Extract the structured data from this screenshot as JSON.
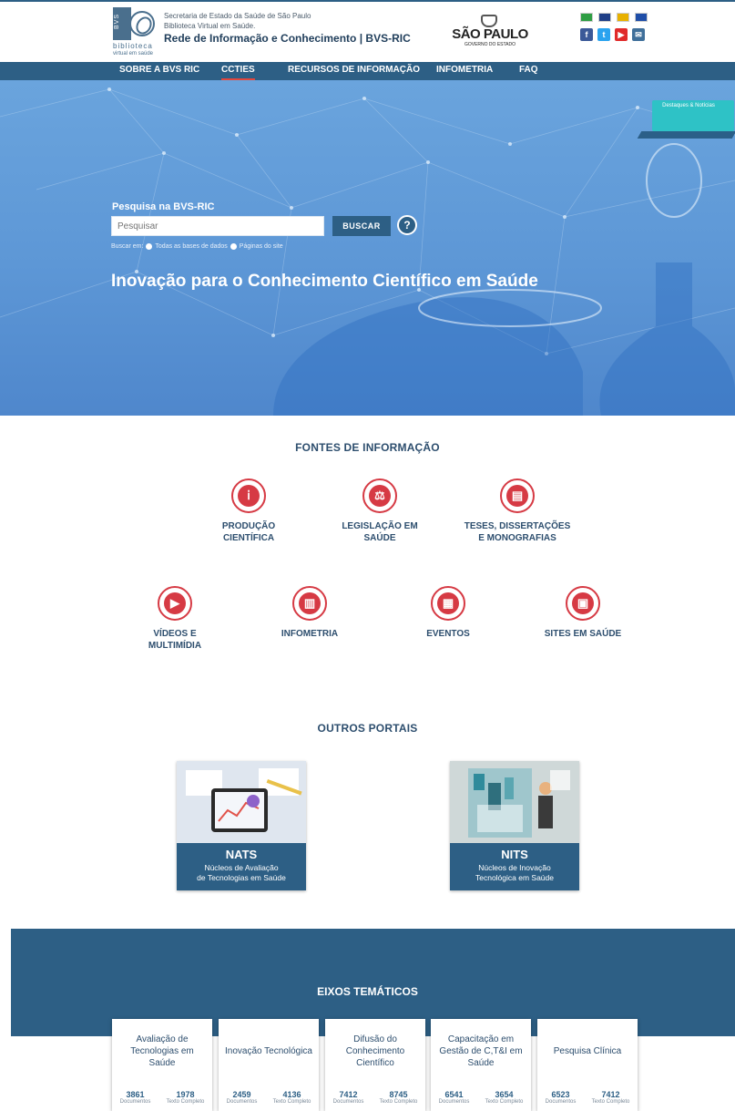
{
  "header": {
    "logo_vertical": "BVS",
    "logo_sub1": "biblioteca",
    "logo_sub2": "virtual em saúde",
    "inst_line1": "Secretaria de Estado da Saúde de São Paulo",
    "inst_line2": "Biblioteca Virtual em Saúde.",
    "site_title": "Rede de Informação e Conhecimento | BVS-RIC",
    "gov_logo_big": "SÃO PAULO",
    "gov_logo_small": "GOVERNO DO ESTADO",
    "flags": [
      {
        "name": "flag-brazil-icon",
        "color": "#2f9e44"
      },
      {
        "name": "flag-uk-icon",
        "color": "#1f3f87"
      },
      {
        "name": "flag-spain-icon",
        "color": "#e8b100"
      },
      {
        "name": "flag-france-icon",
        "color": "#1f4ea8"
      }
    ],
    "socials": [
      {
        "name": "facebook-icon",
        "glyph": "f",
        "color": "#3b5998"
      },
      {
        "name": "twitter-icon",
        "glyph": "t",
        "color": "#2aa3ef"
      },
      {
        "name": "youtube-icon",
        "glyph": "▶",
        "color": "#e02a2a"
      },
      {
        "name": "email-icon",
        "glyph": "✉",
        "color": "#3f6f9a"
      }
    ]
  },
  "nav": {
    "items": [
      "SOBRE A BVS RIC",
      "CCTIES",
      "RECURSOS DE INFORMAÇÃO",
      "INFOMETRIA",
      "FAQ"
    ],
    "active": "CCTIES"
  },
  "hero": {
    "search_label": "Pesquisa na BVS-RIC",
    "search_placeholder": "Pesquisar",
    "search_button": "BUSCAR",
    "help_glyph": "?",
    "radio_prefix": "Buscar em:",
    "radio_option1": "Todas as bases de dados",
    "radio_option2": "Páginas do site",
    "title": "Inovação para o Conhecimento Científico em Saúde",
    "destaques_label": "Destaques & Notícias"
  },
  "fontes": {
    "title": "FONTES DE INFORMAÇÃO",
    "items": [
      {
        "label_lines": [
          "PRODUÇÃO",
          "CIENTÍFICA"
        ],
        "icon": "microscope-icon",
        "glyph": "ⅰ"
      },
      {
        "label_lines": [
          "LEGISLAÇÃO EM",
          "SAÚDE"
        ],
        "icon": "gavel-icon",
        "glyph": "⚖"
      },
      {
        "label_lines": [
          "TESES, DISSERTAÇÕES",
          "E MONOGRAFIAS"
        ],
        "icon": "document-icon",
        "glyph": "▤"
      },
      {
        "label_lines": [
          "VÍDEOS E",
          "MULTIMÍDIA"
        ],
        "icon": "video-icon",
        "glyph": "▶"
      },
      {
        "label_lines": [
          "INFOMETRIA"
        ],
        "icon": "bar-chart-icon",
        "glyph": "▥"
      },
      {
        "label_lines": [
          "EVENTOS"
        ],
        "icon": "calendar-icon",
        "glyph": "▦"
      },
      {
        "label_lines": [
          "SITES EM SAÚDE"
        ],
        "icon": "book-icon",
        "glyph": "▣"
      }
    ]
  },
  "portais": {
    "title": "OUTROS PORTAIS",
    "items": [
      {
        "name": "NATS",
        "desc_line1": "Núcleos de Avaliação",
        "desc_line2": "de Tecnologias em Saúde"
      },
      {
        "name": "NITS",
        "desc_line1": "Núcleos de Inovação",
        "desc_line2": "Tecnológica em Saúde"
      }
    ]
  },
  "eixos": {
    "title": "EIXOS TEMÁTICOS",
    "items": [
      {
        "name": "Avaliação de Tecnologias em Saúde",
        "docs": "3861",
        "docs_label": "Documentos",
        "full": "1978",
        "full_label": "Texto Completo"
      },
      {
        "name": "Inovação Tecnológica",
        "docs": "2459",
        "docs_label": "Documentos",
        "full": "4136",
        "full_label": "Texto Completo"
      },
      {
        "name": "Difusão do Conhecimento Científico",
        "docs": "7412",
        "docs_label": "Documentos",
        "full": "8745",
        "full_label": "Texto Completo"
      },
      {
        "name": "Capacitação em Gestão de C,T&I em Saúde",
        "docs": "6541",
        "docs_label": "Documentos",
        "full": "3654",
        "full_label": "Texto Completo"
      },
      {
        "name": "Pesquisa Clínica",
        "docs": "6523",
        "docs_label": "Documentos",
        "full": "7412",
        "full_label": "Texto Completo"
      }
    ]
  }
}
